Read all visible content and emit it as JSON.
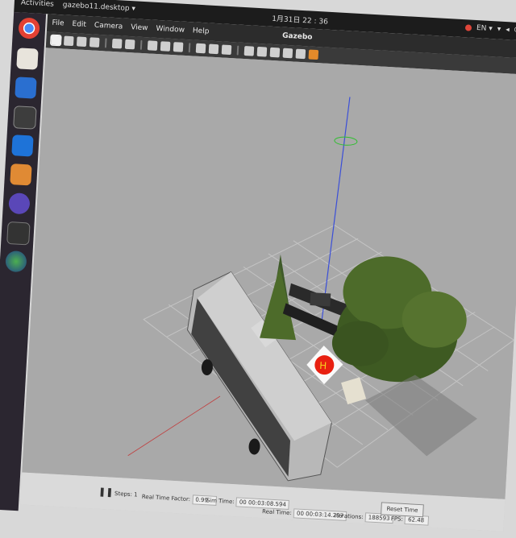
{
  "topbar": {
    "activities": "Activities",
    "app_menu": "gazebo11.desktop ▾",
    "clock": "1月31日 22 : 36",
    "keyboard": "EN ▾",
    "tray_icons": [
      "tray-red-icon",
      "network-icon",
      "volume-icon",
      "power-icon"
    ]
  },
  "dock": {
    "apps": [
      "chrome-icon",
      "files-icon",
      "document-icon",
      "window-icon",
      "teamviewer-icon",
      "sublime-icon",
      "app-icon",
      "terminal-icon",
      "sphere-icon"
    ]
  },
  "window": {
    "title": "Gazebo",
    "menu": [
      "File",
      "Edit",
      "Camera",
      "View",
      "Window",
      "Help"
    ]
  },
  "toolbar": {
    "tools": [
      "select-icon",
      "translate-icon",
      "rotate-icon",
      "scale-icon",
      "undo-icon",
      "redo-icon",
      "box-icon",
      "sphere-shape-icon",
      "cylinder-icon",
      "point-light-icon",
      "spot-light-icon",
      "directional-light-icon",
      "copy-icon",
      "paste-icon",
      "align-icon",
      "snap-icon",
      "change-view-icon",
      "screenshot-icon"
    ]
  },
  "statusbar": {
    "steps_label": "Steps:",
    "steps_value": "1",
    "rtf_label": "Real Time Factor:",
    "rtf_value": "0.99",
    "sim_time_label": "Sim Time:",
    "sim_time_value": "00 00:03:08.594",
    "real_time_label": "Real Time:",
    "real_time_value": "00 00:03:14.297",
    "iterations_label": "Iterations:",
    "iterations_value": "188593",
    "fps_label": "FPS:",
    "fps_value": "62.48",
    "reset_label": "Reset Time"
  },
  "colors": {
    "ground": "#a9a9a9",
    "grid": "#c4c4c4",
    "axis_z": "#3b4fd8",
    "bus": "#b8b8b8",
    "tree": "#4d6b2a",
    "marker": "#e82010"
  }
}
